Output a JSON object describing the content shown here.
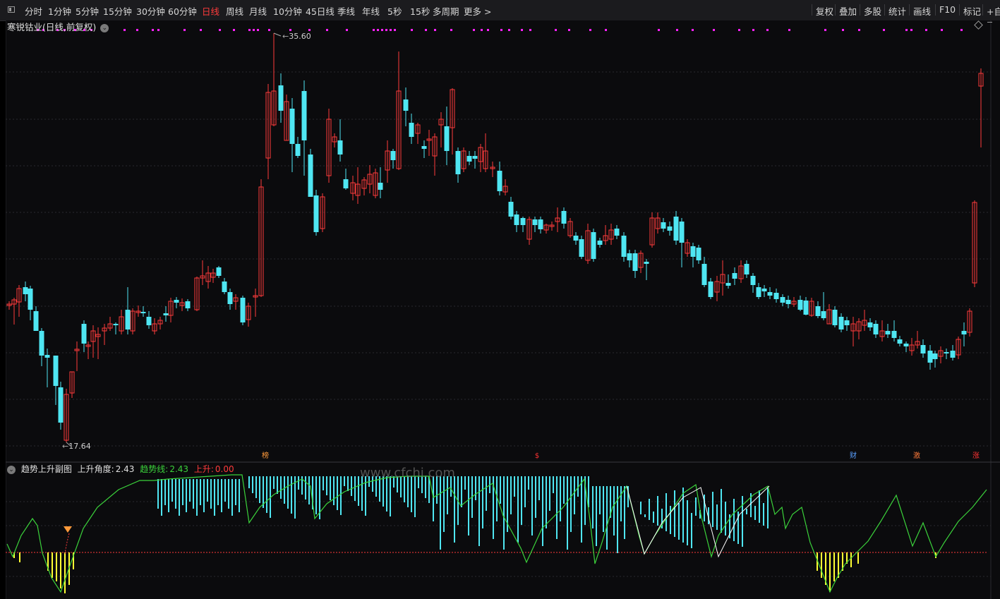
{
  "toolbar": {
    "periods": [
      "分时",
      "1分钟",
      "5分钟",
      "15分钟",
      "30分钟",
      "60分钟",
      "日线",
      "周线",
      "月线",
      "10分钟",
      "45日线",
      "季线",
      "年线",
      "5秒",
      "15秒",
      "多周期",
      "更多 >"
    ],
    "active_period": "日线",
    "right_items": [
      "复权",
      "叠加",
      "多股",
      "统计",
      "画线",
      "F10",
      "标记",
      "+自选"
    ]
  },
  "chart": {
    "title": "寒锐钴业(日线,前复权)",
    "high_label": "35.60",
    "low_label": "17.64",
    "events": [
      {
        "text": "榜",
        "color": "#ff9a3a"
      },
      {
        "text": "$",
        "color": "#ff3333"
      },
      {
        "text": "财",
        "color": "#5aa0ff"
      },
      {
        "text": "激",
        "color": "#ff7a3a"
      },
      {
        "text": "涨",
        "color": "#ff3333"
      }
    ]
  },
  "indicator": {
    "name": "趋势上升副图",
    "angle_label": "上升角度:",
    "angle_value": "2.43",
    "trend_label": "趋势线:",
    "trend_value": "2.43",
    "rise_label": "上升:",
    "rise_value": "0.00"
  },
  "watermark": "www.cfchi.com",
  "colors": {
    "up": "#ff3b3b",
    "down": "#4fe6f2",
    "magenta": "#ff20ff",
    "trend": "#3bd23b",
    "yellow": "#ffff33"
  }
}
